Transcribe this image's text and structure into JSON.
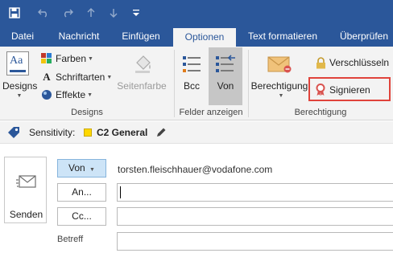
{
  "quick_access": {
    "icons": [
      "save-icon",
      "undo-icon",
      "redo-icon",
      "previous-item-icon",
      "next-item-icon",
      "customize-toolbar-icon"
    ]
  },
  "tabs": [
    {
      "label": "Datei",
      "active": false
    },
    {
      "label": "Nachricht",
      "active": false
    },
    {
      "label": "Einfügen",
      "active": false
    },
    {
      "label": "Optionen",
      "active": true
    },
    {
      "label": "Text formatieren",
      "active": false
    },
    {
      "label": "Überprüfen",
      "active": false
    }
  ],
  "ribbon": {
    "designs_group": {
      "label": "Designs",
      "designs_button": "Designs",
      "farben": "Farben",
      "schriftarten": "Schriftarten",
      "effekte": "Effekte",
      "seitenfarbe": "Seitenfarbe"
    },
    "fields_group": {
      "label": "Felder anzeigen",
      "bcc": "Bcc",
      "von": "Von"
    },
    "permission_group": {
      "label": "Berechtigung",
      "berechtigung": "Berechtigung",
      "verschluesseln": "Verschlüsseln",
      "signieren": "Signieren"
    }
  },
  "sensitivity": {
    "label": "Sensitivity:",
    "value": "C2 General",
    "swatch_color": "#ffd800"
  },
  "compose": {
    "send_label": "Senden",
    "from_button": "Von",
    "from_value": "torsten.fleischhauer@vodafone.com",
    "to_button": "An...",
    "cc_button": "Cc...",
    "subject_label": "Betreff"
  },
  "colors": {
    "accent": "#2b579a",
    "ribbon_bg": "#f3f3f3",
    "highlight_border": "#e0433b"
  }
}
